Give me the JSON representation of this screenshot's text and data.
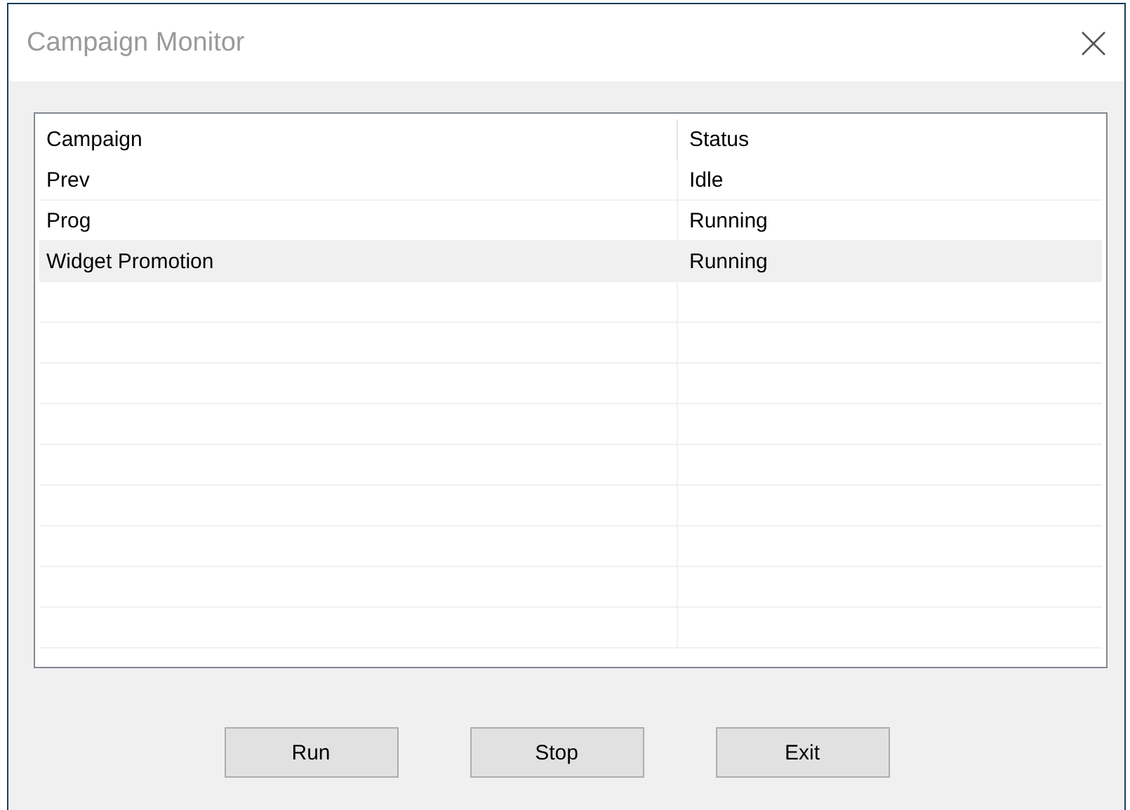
{
  "window": {
    "title": "Campaign Monitor"
  },
  "table": {
    "columns": [
      "Campaign",
      "Status"
    ],
    "rows": [
      {
        "campaign": "Prev",
        "status": "Idle",
        "selected": false
      },
      {
        "campaign": "Prog",
        "status": "Running",
        "selected": false
      },
      {
        "campaign": "Widget Promotion",
        "status": "Running",
        "selected": true
      }
    ]
  },
  "buttons": [
    "Run",
    "Stop",
    "Exit"
  ]
}
